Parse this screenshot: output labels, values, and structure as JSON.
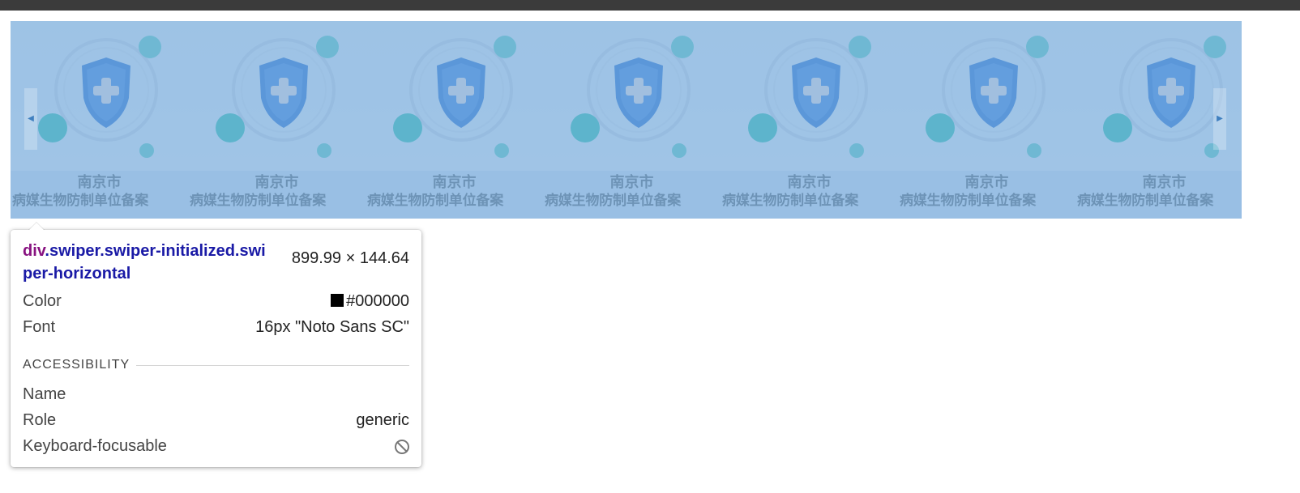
{
  "swiper": {
    "slides": [
      {
        "line1": "南京市",
        "line2": "病媒生物防制单位备案"
      },
      {
        "line1": "南京市",
        "line2": "病媒生物防制单位备案"
      },
      {
        "line1": "南京市",
        "line2": "病媒生物防制单位备案"
      },
      {
        "line1": "南京市",
        "line2": "病媒生物防制单位备案"
      },
      {
        "line1": "南京市",
        "line2": "病媒生物防制单位备案"
      },
      {
        "line1": "南京市",
        "line2": "病媒生物防制单位备案"
      },
      {
        "line1": "南京市",
        "line2": "病媒生物防制单位备案"
      }
    ],
    "prev_icon": "chevron-left-icon",
    "next_icon": "chevron-right-icon",
    "prev_glyph": "◀",
    "next_glyph": "▶",
    "highlight_color": "#6fa8dc"
  },
  "tooltip": {
    "tag": "div",
    "classes": ".swiper.swiper-initialized.swiper-horizontal",
    "size": "899.99 × 144.64",
    "color_label": "Color",
    "color_value": "#000000",
    "font_label": "Font",
    "font_value": "16px \"Noto Sans SC\"",
    "section_label": "ACCESSIBILITY",
    "name_label": "Name",
    "name_value": "",
    "role_label": "Role",
    "role_value": "generic",
    "focus_label": "Keyboard-focusable",
    "focus_icon": "not-allowed-icon"
  }
}
